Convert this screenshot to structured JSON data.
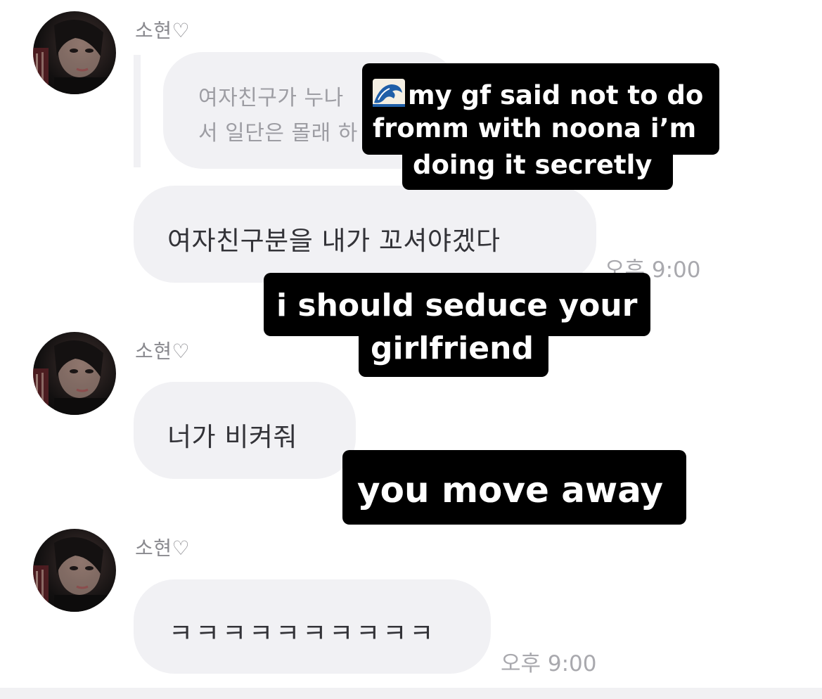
{
  "messages": [
    {
      "sender": "소현♡",
      "reply_preview": {
        "line1": "여자친구가 누나",
        "line2": "서 일단은 몰래 하"
      },
      "text": "여자친구분을 내가 꼬셔야겠다",
      "time": "오후 9:00"
    },
    {
      "sender": "소현♡",
      "text": "너가 비켜줘"
    },
    {
      "sender": "소현♡",
      "text": "ㅋㅋㅋㅋㅋㅋㅋㅋㅋㅋ",
      "time": "오후 9:00"
    }
  ],
  "captions": [
    {
      "icon": "wave-emoji-icon",
      "lines": [
        "my gf said not to do",
        "fromm with noona i’m",
        "doing it secretly"
      ]
    },
    {
      "lines": [
        "i should seduce your",
        "girlfriend"
      ]
    },
    {
      "lines": [
        "you move away"
      ]
    }
  ],
  "colors": {
    "bubble": "#f1f1f4",
    "caption_bg": "#000000",
    "caption_text": "#ffffff",
    "sender": "#8a8a8f",
    "timestamp": "#a9a9ae"
  }
}
